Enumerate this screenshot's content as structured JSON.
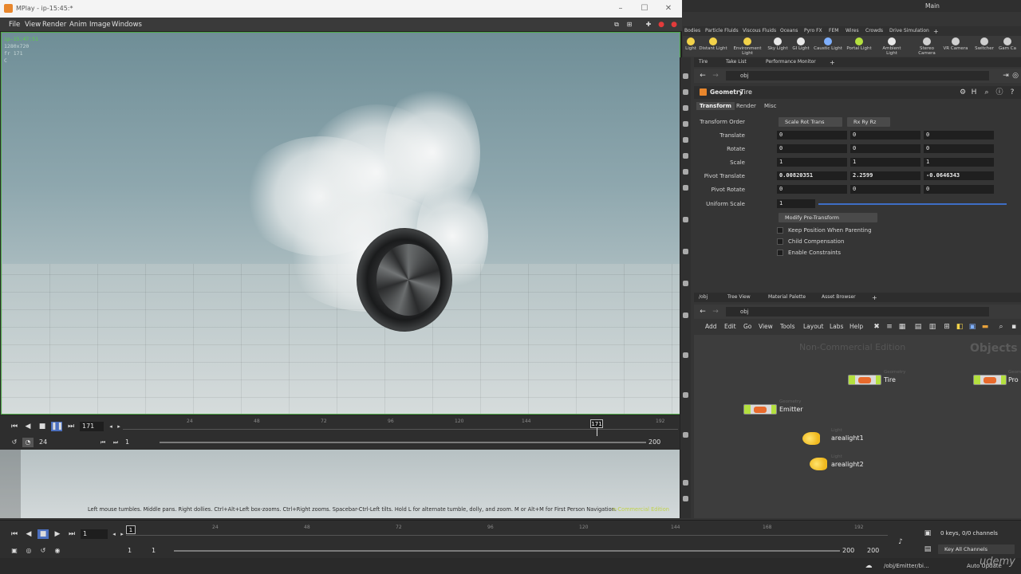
{
  "mplay": {
    "title": "MPlay - ip-15:45:*",
    "menu": [
      "File",
      "View",
      "Render",
      "Anim",
      "Image",
      "Windows"
    ],
    "hud": {
      "line1": "ip-15:47:51",
      "line2": "1280x720",
      "line3": "fr 171",
      "line4": "C"
    },
    "transport": {
      "frame": "171",
      "fps": "24",
      "range_start": "1",
      "range_end": "200",
      "ticks": [
        "24",
        "48",
        "72",
        "96",
        "120",
        "144",
        "192"
      ],
      "current_marker": "171"
    },
    "help_text": "Left mouse tumbles. Middle pans. Right dollies. Ctrl+Alt+Left box-zooms. Ctrl+Right zooms. Spacebar-Ctrl-Left tilts. Hold L for alternate tumble, dolly, and zoom.     M or Alt+M for First Person Navigation.",
    "watermark": "n-Commercial Edition"
  },
  "houdini": {
    "desktop": "Main",
    "shelf_tabs": [
      "Bodies",
      "Particle Fluids",
      "Viscous Fluids",
      "Oceans",
      "Pyro FX",
      "FEM",
      "Wires",
      "Crowds",
      "Drive Simulation"
    ],
    "shelf_tools": [
      {
        "label": "Light",
        "color": "#f2d24a"
      },
      {
        "label": "Distant Light",
        "color": "#f2d24a"
      },
      {
        "label": "Environment Light",
        "color": "#f2d24a"
      },
      {
        "label": "Sky Light",
        "color": "#e8e8e8"
      },
      {
        "label": "GI Light",
        "color": "#e8e8e8"
      },
      {
        "label": "Caustic Light",
        "color": "#7fb0ff"
      },
      {
        "label": "Portal Light",
        "color": "#b4e03f"
      },
      {
        "label": "Ambient Light",
        "color": "#e8e8e8"
      },
      {
        "label": "Stereo Camera",
        "color": "#cfcfcf"
      },
      {
        "label": "VR Camera",
        "color": "#cfcfcf"
      },
      {
        "label": "Switcher",
        "color": "#cfcfcf"
      },
      {
        "label": "Gam Ca",
        "color": "#cfcfcf"
      }
    ],
    "param_pane_tabs": [
      "Tire",
      "Take List",
      "Performance Monitor"
    ],
    "param_path": "obj",
    "node_type": "Geometry",
    "node_name": "Tire",
    "sub_tabs": [
      "Transform",
      "Render",
      "Misc"
    ],
    "params": {
      "transform_order_label": "Transform Order",
      "transform_order": "Scale Rot Trans",
      "rot_order": "Rx Ry Rz",
      "rows": [
        {
          "label": "Translate",
          "v": [
            "0",
            "0",
            "0"
          ],
          "bold": false
        },
        {
          "label": "Rotate",
          "v": [
            "0",
            "0",
            "0"
          ],
          "bold": false
        },
        {
          "label": "Scale",
          "v": [
            "1",
            "1",
            "1"
          ],
          "bold": false
        },
        {
          "label": "Pivot Translate",
          "v": [
            "0.00820351",
            "2.2599",
            "-0.0646343"
          ],
          "bold": true
        },
        {
          "label": "Pivot Rotate",
          "v": [
            "0",
            "0",
            "0"
          ],
          "bold": false
        }
      ],
      "uniform_scale_label": "Uniform Scale",
      "uniform_scale": "1",
      "pre_transform_menu": "Modify Pre-Transform",
      "checks": [
        "Keep Position When Parenting",
        "Child Compensation",
        "Enable Constraints"
      ]
    },
    "net_tabs": [
      "/obj",
      "Tree View",
      "Material Palette",
      "Asset Browser"
    ],
    "net_path": "obj",
    "net_menu": [
      "Add",
      "Edit",
      "Go",
      "View",
      "Tools",
      "Layout",
      "Labs",
      "Help"
    ],
    "net_watermark": "Non-Commercial Edition",
    "net_context": "Objects",
    "nodes": [
      {
        "name": "Tire",
        "type": "Geometry"
      },
      {
        "name": "Pro",
        "type": "Geom"
      },
      {
        "name": "Emitter",
        "type": "Geometry"
      },
      {
        "name": "arealight1",
        "type": "Light"
      },
      {
        "name": "arealight2",
        "type": "Light"
      }
    ],
    "timeline": {
      "frame": "1",
      "start": "1",
      "start2": "1",
      "end": "200",
      "end2": "200",
      "ticks": [
        "24",
        "48",
        "72",
        "96",
        "120",
        "144",
        "168",
        "192"
      ],
      "keys": "0 keys, 0/0 channels",
      "key_all": "Key All Channels"
    },
    "status_path": "/obj/Emitter/bi...",
    "auto_update": "Auto Update"
  },
  "branding": {
    "udemy": "udemy"
  }
}
